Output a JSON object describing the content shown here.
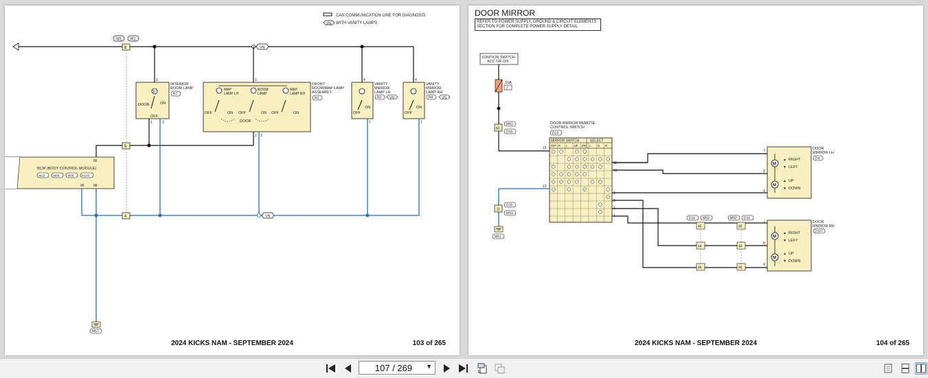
{
  "left_page": {
    "legend": {
      "can_line": "CAN COMMUNICATION LINE FOR DIAGNOSIS",
      "vn_tag": "VN",
      "vn_text": "WITH VANITY LAMPS"
    },
    "connectors": {
      "m1": "M1",
      "r1": "R1"
    },
    "terminals": {
      "t8": "8",
      "t5": "5",
      "t4": "4"
    },
    "components": {
      "interior_lamp": {
        "name_line1": "INTERIOR",
        "name_line2": "ROOM LAMP",
        "code": "R7",
        "door": "DOOR",
        "on": "ON",
        "off": "OFF",
        "pin_top": "2",
        "pin1": "1",
        "pin3": "3"
      },
      "front_lamp": {
        "name_line1": "FRONT",
        "name_line2": "ROOM/MAP LAMP",
        "name_line3": "ASSEMBLY",
        "code": "R2",
        "map_lh_1": "MAP",
        "map_lh_2": "LAMP LH",
        "room_1": "ROOM",
        "room_2": "LAMP",
        "map_rh_1": "MAP",
        "map_rh_2": "LAMP RH",
        "off": "OFF",
        "on": "ON",
        "door": "DOOR",
        "pin_top": "2",
        "pin1": "1",
        "pin3": "3"
      },
      "vanity_lh": {
        "name_line1": "VANITY",
        "name_line2": "MIRROR",
        "name_line3": "LAMP LH",
        "code": "R3",
        "off": "OFF",
        "on": "ON",
        "pin_top": "4",
        "pin1": "1"
      },
      "vanity_rh": {
        "name_line1": "VANITY",
        "name_line2": "MIRROR",
        "name_line3": "LAMP RH",
        "code": "R9",
        "off": "OFF",
        "on": "ON",
        "pin_top": "4",
        "pin1": "1"
      },
      "bcm": {
        "name": "BCM (BODY CONTROL MODULE)",
        "codes": [
          "M18",
          "M88",
          "M99",
          "M100"
        ],
        "pin86": "86",
        "pin99": "99",
        "pin88": "88"
      }
    },
    "ground": "M57",
    "footer_title": "2024 KICKS NAM - SEPTEMBER 2024",
    "footer_page": "103 of 265"
  },
  "right_page": {
    "title": "DOOR MIRROR",
    "note": "REFER TO POWER SUPPLY, GROUND & CIRCUIT ELEMENTS SECTION FOR COMPLETE POWER SUPPLY DETAIL.",
    "ignition_line1": "IGNITION SWITCH",
    "ignition_line2": "ACC OR ON",
    "fuse_amp": "10A",
    "fuse_no": "2",
    "conn43": "43",
    "m93": "M93",
    "d16": "D16",
    "conn11": "11",
    "ground": "M61",
    "switch": {
      "name_line1": "DOOR MIRROR REMOTE",
      "name_line2": "CONTROL SWITCH",
      "code": "D13",
      "header_mirror": "MIRROR SWITCH",
      "header_select": "SELECT",
      "cols": [
        "OFF",
        "R",
        "L",
        "UP",
        "DN",
        "L",
        "N",
        "R"
      ],
      "pins_left": [
        "15",
        "10"
      ],
      "pins_right": [
        "11",
        "12",
        "9",
        "3",
        "1",
        "4"
      ]
    },
    "mirror_lh": {
      "name_line1": "DOOR",
      "name_line2": "MIRROR LH",
      "code": "D4",
      "right": "RIGHT",
      "left": "LEFT",
      "up": "UP",
      "down": "DOWN",
      "pins": [
        "7",
        "8",
        "4"
      ]
    },
    "mirror_rh": {
      "name_line1": "DOOR",
      "name_line2": "MIRROR RH",
      "code": "D107",
      "right": "RIGHT",
      "left": "LEFT",
      "up": "UP",
      "down": "DOWN",
      "pins": [
        "7",
        "8",
        "4"
      ]
    },
    "joint": {
      "d16_a": "D16",
      "m93_a": "M93",
      "m92": "M92",
      "d16_b": "D16",
      "nums": [
        "45",
        "44",
        "46"
      ]
    },
    "footer_title": "2024 KICKS NAM - SEPTEMBER 2024",
    "footer_page": "104 of 265"
  },
  "toolbar": {
    "page_value": "107 / 269",
    "icons": [
      "first-page-icon",
      "previous-page-icon",
      "next-page-icon",
      "last-page-icon",
      "rotate-icon",
      "extract-icon",
      "single-page-view-icon",
      "continuous-view-icon",
      "facing-view-icon"
    ]
  },
  "colors": {
    "blue_wire": "#1a6fbf",
    "black_wire": "#111111",
    "component_fill": "#f8f0c0",
    "accent": "#7fa7d9"
  }
}
